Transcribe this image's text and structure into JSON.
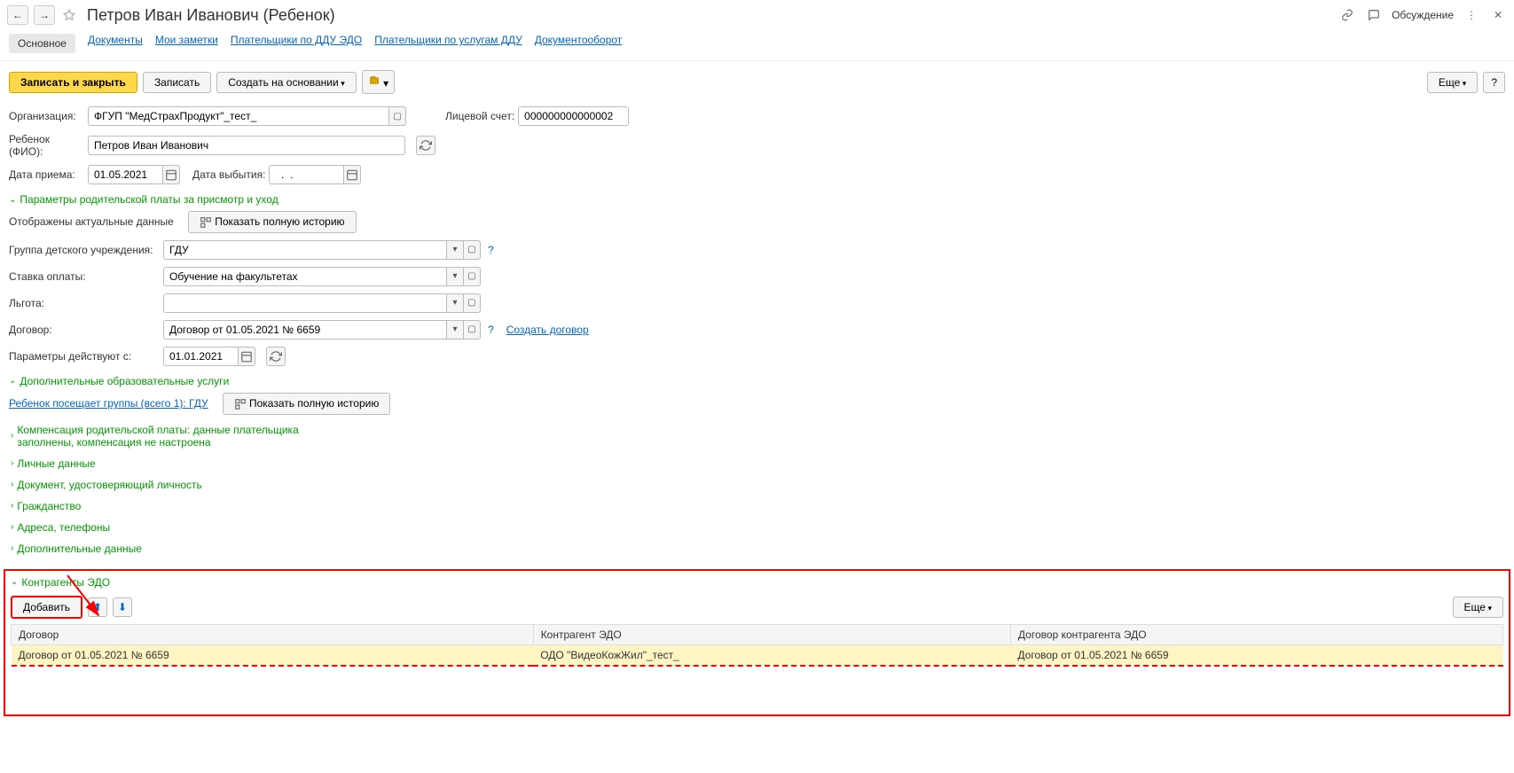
{
  "header": {
    "title": "Петров Иван Иванович (Ребенок)",
    "discuss": "Обсуждение"
  },
  "tabs": {
    "main": "Основное",
    "docs": "Документы",
    "notes": "Мои заметки",
    "payers_edo": "Плательщики по ДДУ ЭДО",
    "payers_ddu": "Плательщики по услугам ДДУ",
    "workflow": "Документооборот"
  },
  "toolbar": {
    "save_close": "Записать и закрыть",
    "save": "Записать",
    "create_based": "Создать на основании",
    "more": "Еще",
    "help": "?"
  },
  "form": {
    "org_label": "Организация:",
    "org_value": "ФГУП \"МедСтрахПродукт\"_тест_",
    "account_label": "Лицевой счет:",
    "account_value": "000000000000002",
    "child_label": "Ребенок (ФИО):",
    "child_value": "Петров Иван Иванович",
    "date_in_label": "Дата приема:",
    "date_in_value": "01.05.2021",
    "date_out_label": "Дата выбытия:",
    "date_out_value": "  .  .    "
  },
  "section_params": {
    "title": "Параметры родительской платы за присмотр и уход",
    "actual_text": "Отображены актуальные данные",
    "show_history": "Показать полную историю",
    "group_label": "Группа детского учреждения:",
    "group_value": "ГДУ",
    "rate_label": "Ставка оплаты:",
    "rate_value": "Обучение на факультетах",
    "benefit_label": "Льгота:",
    "benefit_value": "",
    "contract_label": "Договор:",
    "contract_value": "Договор от 01.05.2021 № 6659",
    "create_contract": "Создать договор",
    "valid_from_label": "Параметры действуют с:",
    "valid_from_value": "01.01.2021"
  },
  "section_edu": {
    "title": "Дополнительные образовательные услуги",
    "child_groups": "Ребенок посещает группы (всего 1): ГДУ",
    "show_history": "Показать полную историю"
  },
  "sections": {
    "compensation": "Компенсация родительской платы: данные плательщика заполнены, компенсация не настроена",
    "personal": "Личные данные",
    "identity": "Документ, удостоверяющий личность",
    "citizenship": "Гражданство",
    "addresses": "Адреса, телефоны",
    "additional": "Дополнительные данные",
    "edo": "Контрагенты ЭДО"
  },
  "edo_table": {
    "add": "Добавить",
    "more": "Еще",
    "col_contract": "Договор",
    "col_counterparty": "Контрагент ЭДО",
    "col_cp_contract": "Договор контрагента ЭДО",
    "row": {
      "contract": "Договор от 01.05.2021 № 6659",
      "counterparty": "ОДО \"ВидеоКожЖил\"_тест_",
      "cp_contract": "Договор от 01.05.2021 № 6659"
    }
  }
}
